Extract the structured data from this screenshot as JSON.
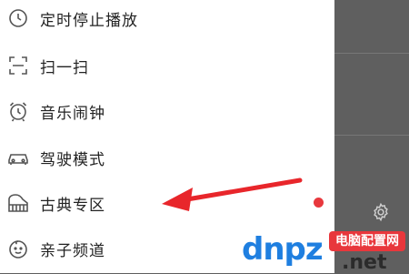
{
  "menu": {
    "items": [
      {
        "label": "定时停止播放",
        "icon": "clock-icon"
      },
      {
        "label": "扫一扫",
        "icon": "scan-icon"
      },
      {
        "label": "音乐闹钟",
        "icon": "alarm-clock-icon"
      },
      {
        "label": "驾驶模式",
        "icon": "car-icon"
      },
      {
        "label": "古典专区",
        "icon": "piano-icon"
      },
      {
        "label": "亲子频道",
        "icon": "child-face-icon"
      }
    ]
  },
  "background": {
    "icon": "gear-icon"
  },
  "annotation": {
    "color": "#e8262b",
    "points_to": "古典专区"
  },
  "watermark": {
    "latin": "dnpz",
    "badge": "电脑配置网",
    "suffix": ".net"
  },
  "colors": {
    "drawer": "#ffffff",
    "overlay": "#5f5f5f",
    "dot": "#e8383d",
    "text": "#222222"
  }
}
